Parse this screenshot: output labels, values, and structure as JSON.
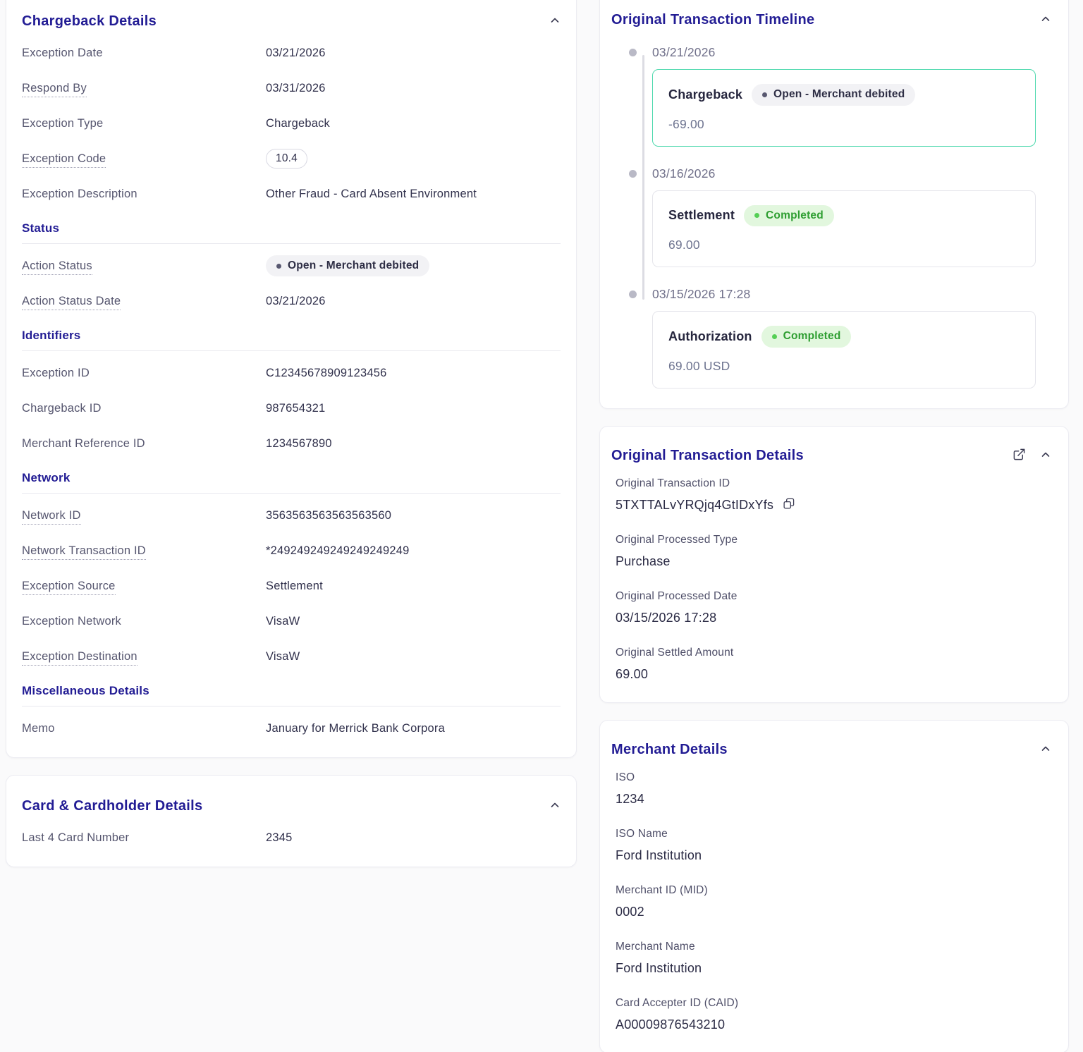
{
  "colors": {
    "accent_indigo": "#221c94",
    "teal_highlight": "#4fd9ae",
    "green_badge_bg": "#e2f7de",
    "green_badge_text": "#2e9e31",
    "gray_badge_bg": "#f2f2f5",
    "page_bg": "#fafafb"
  },
  "chargeback_panel": {
    "title": "Chargeback Details",
    "groups": [
      {
        "rows": [
          {
            "label": "Exception Date",
            "value": "03/21/2026"
          },
          {
            "label": "Respond By",
            "value": "03/31/2026"
          },
          {
            "label": "Exception Type",
            "value": "Chargeback"
          },
          {
            "label": "Exception Code",
            "value": "10.4"
          },
          {
            "label": "Exception Description",
            "value": "Other Fraud - Card Absent Environment"
          }
        ]
      },
      {
        "header": "Status",
        "rows": [
          {
            "label": "Action Status",
            "value": "Open - Merchant debited"
          },
          {
            "label": "Action Status Date",
            "value": "03/21/2026"
          }
        ]
      },
      {
        "header": "Identifiers",
        "rows": [
          {
            "label": "Exception ID",
            "value": "C12345678909123456"
          },
          {
            "label": "Chargeback ID",
            "value": "987654321"
          },
          {
            "label": "Merchant Reference ID",
            "value": "1234567890"
          }
        ]
      },
      {
        "header": "Network",
        "rows": [
          {
            "label": "Network ID",
            "value": "3563563563563563560"
          },
          {
            "label": "Network Transaction ID",
            "value": "*249249249249249249249"
          },
          {
            "label": "Exception Source",
            "value": "Settlement"
          },
          {
            "label": "Exception Network",
            "value": "VisaW"
          },
          {
            "label": "Exception Destination",
            "value": "VisaW"
          }
        ]
      },
      {
        "header": "Miscellaneous Details",
        "rows": [
          {
            "label": "Memo",
            "value": "January for Merrick Bank Corpora"
          }
        ]
      }
    ]
  },
  "card_panel": {
    "title": "Card & Cardholder Details",
    "rows": [
      {
        "label": "Last 4 Card Number",
        "value": "2345"
      }
    ]
  },
  "timeline_panel": {
    "title": "Original Transaction Timeline",
    "events": [
      {
        "date": "03/21/2026",
        "name": "Chargeback",
        "status": "Open - Merchant debited",
        "status_type": "gray",
        "amount": "-69.00"
      },
      {
        "date": "03/16/2026",
        "name": "Settlement",
        "status": "Completed",
        "status_type": "green",
        "amount": "69.00"
      },
      {
        "date": "03/15/2026 17:28",
        "name": "Authorization",
        "status": "Completed",
        "status_type": "green",
        "amount": "69.00 USD"
      }
    ]
  },
  "transaction_panel": {
    "title": "Original Transaction Details",
    "fields": [
      {
        "label": "Original Transaction ID",
        "value": "5TXTTALvYRQjq4GtIDxYfs"
      },
      {
        "label": "Original Processed Type",
        "value": "Purchase"
      },
      {
        "label": "Original Processed Date",
        "value": "03/15/2026 17:28"
      },
      {
        "label": "Original Settled Amount",
        "value": "69.00"
      }
    ]
  },
  "merchant_panel": {
    "title": "Merchant Details",
    "fields": [
      {
        "label": "ISO",
        "value": "1234"
      },
      {
        "label": "ISO Name",
        "value": "Ford Institution"
      },
      {
        "label": "Merchant ID (MID)",
        "value": "0002"
      },
      {
        "label": "Merchant Name",
        "value": "Ford Institution"
      },
      {
        "label": "Card Accepter ID (CAID)",
        "value": "A00009876543210"
      }
    ]
  }
}
